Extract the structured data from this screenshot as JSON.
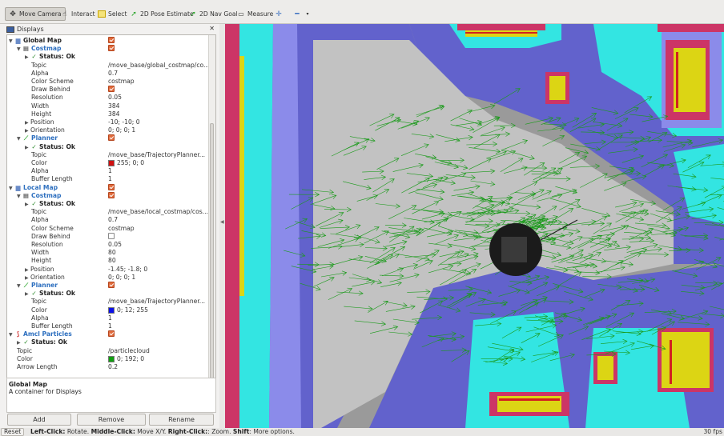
{
  "toolbar": {
    "items": [
      {
        "label": "Move Camera",
        "icon": "move-camera-icon"
      },
      {
        "label": "Interact",
        "icon": "hand-icon"
      },
      {
        "label": "Select",
        "icon": "select-box-icon"
      },
      {
        "label": "2D Pose Estimate",
        "icon": "green-arrow-icon"
      },
      {
        "label": "2D Nav Goal",
        "icon": "green-arrow-icon"
      },
      {
        "label": "Measure",
        "icon": "ruler-icon"
      }
    ]
  },
  "panel": {
    "title": "Displays",
    "rows": [
      {
        "kind": "grp",
        "label": "Global Map",
        "check": true,
        "level": 0,
        "arrow": "▼",
        "icon": "folder"
      },
      {
        "kind": "blue",
        "label": "Costmap",
        "check": true,
        "level": 1,
        "arrow": "▼",
        "icon": "grid"
      },
      {
        "kind": "stat",
        "label": "Status: Ok",
        "level": 2,
        "arrow": "▶",
        "icon": "tick"
      },
      {
        "kind": "prop",
        "label": "Topic",
        "value": "/move_base/global_costmap/co...",
        "level": 3
      },
      {
        "kind": "prop",
        "label": "Alpha",
        "value": "0.7",
        "level": 3
      },
      {
        "kind": "prop",
        "label": "Color Scheme",
        "value": "costmap",
        "level": 3
      },
      {
        "kind": "prop",
        "label": "Draw Behind",
        "check": true,
        "level": 3
      },
      {
        "kind": "prop",
        "label": "Resolution",
        "value": "0.05",
        "level": 3
      },
      {
        "kind": "prop",
        "label": "Width",
        "value": "384",
        "level": 3
      },
      {
        "kind": "prop",
        "label": "Height",
        "value": "384",
        "level": 3
      },
      {
        "kind": "prop",
        "label": "Position",
        "value": "-10; -10; 0",
        "level": 2,
        "arrow": "▶"
      },
      {
        "kind": "prop",
        "label": "Orientation",
        "value": "0; 0; 0; 1",
        "level": 2,
        "arrow": "▶"
      },
      {
        "kind": "blue",
        "label": "Planner",
        "check": true,
        "level": 1,
        "arrow": "▼",
        "icon": "path"
      },
      {
        "kind": "stat",
        "label": "Status: Ok",
        "level": 2,
        "arrow": "▶",
        "icon": "tick"
      },
      {
        "kind": "prop",
        "label": "Topic",
        "value": "/move_base/TrajectoryPlanner...",
        "level": 3
      },
      {
        "kind": "prop",
        "label": "Color",
        "value": "255; 0; 0",
        "swatch": "#d01010",
        "level": 3
      },
      {
        "kind": "prop",
        "label": "Alpha",
        "value": "1",
        "level": 3
      },
      {
        "kind": "prop",
        "label": "Buffer Length",
        "value": "1",
        "level": 3
      },
      {
        "kind": "blue",
        "label": "Local Map",
        "check": true,
        "level": 0,
        "arrow": "▼",
        "icon": "folder"
      },
      {
        "kind": "blue",
        "label": "Costmap",
        "check": true,
        "level": 1,
        "arrow": "▼",
        "icon": "grid"
      },
      {
        "kind": "stat",
        "label": "Status: Ok",
        "level": 2,
        "arrow": "▶",
        "icon": "tick"
      },
      {
        "kind": "prop",
        "label": "Topic",
        "value": "/move_base/local_costmap/cos...",
        "level": 3
      },
      {
        "kind": "prop",
        "label": "Alpha",
        "value": "0.7",
        "level": 3
      },
      {
        "kind": "prop",
        "label": "Color Scheme",
        "value": "costmap",
        "level": 3
      },
      {
        "kind": "prop",
        "label": "Draw Behind",
        "check": false,
        "level": 3
      },
      {
        "kind": "prop",
        "label": "Resolution",
        "value": "0.05",
        "level": 3
      },
      {
        "kind": "prop",
        "label": "Width",
        "value": "80",
        "level": 3
      },
      {
        "kind": "prop",
        "label": "Height",
        "value": "80",
        "level": 3
      },
      {
        "kind": "prop",
        "label": "Position",
        "value": "-1.45; -1.8; 0",
        "level": 2,
        "arrow": "▶"
      },
      {
        "kind": "prop",
        "label": "Orientation",
        "value": "0; 0; 0; 1",
        "level": 2,
        "arrow": "▶"
      },
      {
        "kind": "blue",
        "label": "Planner",
        "check": true,
        "level": 1,
        "arrow": "▼",
        "icon": "path"
      },
      {
        "kind": "stat",
        "label": "Status: Ok",
        "level": 2,
        "arrow": "▶",
        "icon": "tick"
      },
      {
        "kind": "prop",
        "label": "Topic",
        "value": "/move_base/TrajectoryPlanner...",
        "level": 3
      },
      {
        "kind": "prop",
        "label": "Color",
        "value": "0; 12; 255",
        "swatch": "#0c10e8",
        "level": 3
      },
      {
        "kind": "prop",
        "label": "Alpha",
        "value": "1",
        "level": 3
      },
      {
        "kind": "prop",
        "label": "Buffer Length",
        "value": "1",
        "level": 3
      },
      {
        "kind": "blue",
        "label": "Amcl Particles",
        "check": true,
        "level": 0,
        "arrow": "▼",
        "icon": "particles"
      },
      {
        "kind": "stat",
        "label": "Status: Ok",
        "level": 1,
        "arrow": "▶",
        "icon": "tick"
      },
      {
        "kind": "prop",
        "label": "Topic",
        "value": "/particlecloud",
        "level": 1
      },
      {
        "kind": "prop",
        "label": "Color",
        "value": "0; 192; 0",
        "swatch": "#10a010",
        "level": 1
      },
      {
        "kind": "prop",
        "label": "Arrow Length",
        "value": "0.2",
        "level": 1
      }
    ],
    "description_title": "Global Map",
    "description_text": "A container for Displays",
    "buttons": {
      "add": "Add",
      "remove": "Remove",
      "rename": "Rename"
    }
  },
  "status": {
    "reset": "Reset",
    "hint_parts": [
      {
        "b": "Left-Click:",
        "t": " Rotate. "
      },
      {
        "b": "Middle-Click:",
        "t": " Move X/Y. "
      },
      {
        "b": "Right-Click:",
        "t": ": Zoom. "
      },
      {
        "b": "Shift",
        "t": ": More options."
      }
    ],
    "fps": "30 fps"
  },
  "colors": {
    "unknown": "#9a9a9a",
    "free": "#c2c2c2",
    "inflation_dark": "#6262cc",
    "inflation_mid": "#8b8bea",
    "inflation_light": "#b7b7f1",
    "cyan": "#33e5e2",
    "magenta": "#cc3566",
    "yellow": "#dcd514",
    "lethal": "#d22020",
    "particles": "#1a9a1a"
  }
}
